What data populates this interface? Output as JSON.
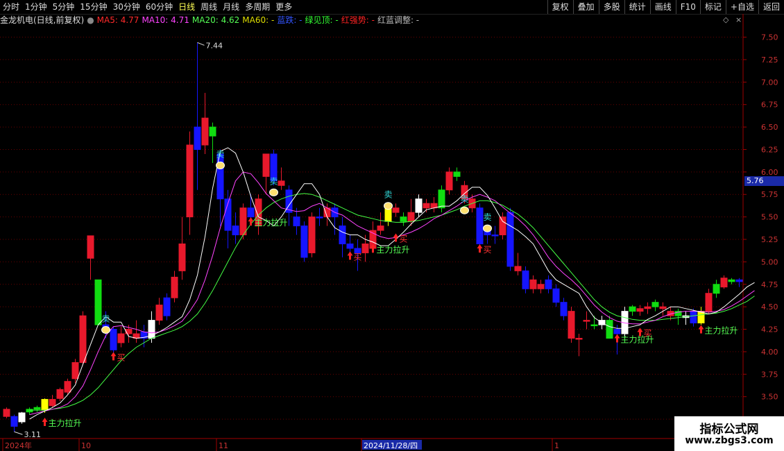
{
  "toolbar": {
    "periods": [
      "分时",
      "1分钟",
      "5分钟",
      "15分钟",
      "30分钟",
      "60分钟",
      "日线",
      "周线",
      "月线",
      "多周期",
      "更多"
    ],
    "active_index": 6,
    "right_buttons": [
      "复权",
      "叠加",
      "多股",
      "统计",
      "画线",
      "F10",
      "标记",
      "+自选",
      "返回"
    ]
  },
  "legend": {
    "title": "金龙机电(日线,前复权)",
    "ma5": "MA5: 4.77",
    "ma10": "MA10: 4.71",
    "ma20": "MA20: 4.62",
    "ma60": "MA60: -",
    "blue_fall": "蓝跌: -",
    "green_top": "绿见顶: -",
    "red_strong": "红强势: -",
    "redblue": "红蓝调整: -"
  },
  "current_price": "5.76",
  "watermark": {
    "line1": "指标公式网",
    "line2": "www.zbgs3.com"
  },
  "chart_data": {
    "type": "candlestick",
    "ylim": [
      3.05,
      7.62
    ],
    "y_ticks": [
      3.25,
      3.5,
      3.75,
      4.0,
      4.25,
      4.5,
      4.75,
      5.0,
      5.25,
      5.5,
      5.75,
      6.0,
      6.25,
      6.5,
      6.75,
      7.0,
      7.25,
      7.5
    ],
    "x_labels": [
      {
        "text": "2024年",
        "index": 0
      },
      {
        "text": "10",
        "index": 10
      },
      {
        "text": "11",
        "index": 28
      },
      {
        "text": "2024/11/28/四",
        "index": 47,
        "highlight": true
      },
      {
        "text": "1",
        "index": 72
      }
    ],
    "high_marker": {
      "text": "7.44",
      "index": 25
    },
    "low_marker": {
      "text": "3.11",
      "index": 1
    },
    "colors": {
      "red": "#e8192c",
      "blue": "#1515ff",
      "green": "#11dd11",
      "yellow": "#ffff00",
      "white": "#ffffff",
      "ma5": "#ffffff",
      "ma10": "#ff44ff",
      "ma20": "#44ff44"
    },
    "candles": [
      [
        "red",
        3.36,
        3.28,
        3.38,
        3.26
      ],
      [
        "blue",
        3.28,
        3.17,
        3.3,
        3.11
      ],
      [
        "white",
        3.22,
        3.32,
        3.33,
        3.2
      ],
      [
        "green",
        3.33,
        3.36,
        3.38,
        3.3
      ],
      [
        "green",
        3.36,
        3.38,
        3.4,
        3.33
      ],
      [
        "yellow",
        3.35,
        3.47,
        3.48,
        3.32
      ],
      [
        "red",
        3.4,
        3.47,
        3.52,
        3.38
      ],
      [
        "red",
        3.48,
        3.58,
        3.6,
        3.45
      ],
      [
        "red",
        3.55,
        3.67,
        3.7,
        3.52
      ],
      [
        "red",
        3.7,
        3.88,
        3.92,
        3.65
      ],
      [
        "red",
        3.88,
        4.4,
        4.45,
        3.85
      ],
      [
        "red",
        5.04,
        5.29,
        5.29,
        4.8
      ],
      [
        "green",
        4.8,
        4.3,
        4.8,
        4.3
      ],
      [
        "blue",
        4.3,
        4.25,
        4.45,
        4.15
      ],
      [
        "blue",
        4.25,
        4.02,
        4.28,
        3.95
      ],
      [
        "red",
        4.1,
        4.2,
        4.28,
        4.05
      ],
      [
        "red",
        4.2,
        4.25,
        4.3,
        4.1
      ],
      [
        "red",
        4.15,
        4.2,
        4.35,
        4.1
      ],
      [
        "blue",
        4.22,
        4.15,
        4.3,
        4.05
      ],
      [
        "white",
        4.15,
        4.35,
        4.45,
        4.1
      ],
      [
        "red",
        4.35,
        4.52,
        4.6,
        4.3
      ],
      [
        "blue",
        4.6,
        4.4,
        4.65,
        4.35
      ],
      [
        "red",
        4.6,
        4.83,
        4.9,
        4.55
      ],
      [
        "red",
        4.9,
        5.2,
        5.5,
        4.8
      ],
      [
        "red",
        5.5,
        6.3,
        6.45,
        5.3
      ],
      [
        "blue",
        6.5,
        6.25,
        7.44,
        5.8
      ],
      [
        "red",
        6.3,
        6.6,
        6.88,
        6.2
      ],
      [
        "green",
        6.5,
        6.4,
        6.55,
        6.1
      ],
      [
        "blue",
        6.2,
        5.7,
        6.25,
        5.4
      ],
      [
        "blue",
        5.7,
        5.35,
        5.8,
        5.15
      ],
      [
        "blue",
        5.4,
        5.3,
        5.55,
        5.2
      ],
      [
        "red",
        5.3,
        5.6,
        5.65,
        5.25
      ],
      [
        "blue",
        5.6,
        5.5,
        5.75,
        5.45
      ],
      [
        "red",
        5.4,
        5.7,
        5.75,
        5.3
      ],
      [
        "red",
        5.95,
        6.2,
        6.2,
        5.75
      ],
      [
        "blue",
        6.2,
        5.9,
        6.25,
        5.85
      ],
      [
        "red",
        5.9,
        5.85,
        6.05,
        5.8
      ],
      [
        "blue",
        5.8,
        5.55,
        5.85,
        5.4
      ],
      [
        "blue",
        5.5,
        5.4,
        5.6,
        5.3
      ],
      [
        "blue",
        5.4,
        5.05,
        5.45,
        5.0
      ],
      [
        "red",
        5.1,
        5.5,
        5.55,
        5.05
      ],
      [
        "blue",
        5.5,
        5.5,
        5.6,
        5.4
      ],
      [
        "red",
        5.5,
        5.6,
        5.65,
        5.4
      ],
      [
        "blue",
        5.6,
        5.5,
        5.65,
        5.3
      ],
      [
        "blue",
        5.4,
        5.2,
        5.5,
        5.05
      ],
      [
        "blue",
        5.2,
        5.15,
        5.3,
        5.05
      ],
      [
        "blue",
        5.15,
        5.1,
        5.25,
        4.9
      ],
      [
        "red",
        5.1,
        5.2,
        5.3,
        5.0
      ],
      [
        "red",
        5.15,
        5.35,
        5.45,
        5.1
      ],
      [
        "red",
        5.35,
        5.4,
        5.55,
        5.3
      ],
      [
        "yellow",
        5.45,
        5.6,
        5.65,
        5.4
      ],
      [
        "red",
        5.55,
        5.6,
        5.65,
        5.5
      ],
      [
        "green",
        5.5,
        5.45,
        5.55,
        5.4
      ],
      [
        "red",
        5.45,
        5.55,
        5.7,
        5.4
      ],
      [
        "white",
        5.55,
        5.7,
        5.75,
        5.5
      ],
      [
        "red",
        5.6,
        5.65,
        5.7,
        5.55
      ],
      [
        "red",
        5.65,
        5.6,
        5.72,
        5.55
      ],
      [
        "green",
        5.6,
        5.8,
        5.85,
        5.55
      ],
      [
        "red",
        5.8,
        6.0,
        6.05,
        5.75
      ],
      [
        "green",
        5.95,
        6.0,
        6.05,
        5.9
      ],
      [
        "red",
        5.85,
        5.7,
        5.9,
        5.65
      ],
      [
        "red",
        5.7,
        5.6,
        5.75,
        5.55
      ],
      [
        "blue",
        5.6,
        5.2,
        5.65,
        5.15
      ],
      [
        "blue",
        5.35,
        5.3,
        5.4,
        5.2
      ],
      [
        "blue",
        5.3,
        5.3,
        5.4,
        5.2
      ],
      [
        "red",
        5.3,
        5.5,
        5.55,
        5.25
      ],
      [
        "blue",
        5.55,
        4.95,
        5.6,
        4.9
      ],
      [
        "red",
        4.95,
        4.9,
        5.1,
        4.85
      ],
      [
        "blue",
        4.9,
        4.7,
        4.95,
        4.65
      ],
      [
        "red",
        4.8,
        4.7,
        4.85,
        4.65
      ],
      [
        "red",
        4.7,
        4.75,
        4.8,
        4.65
      ],
      [
        "blue",
        4.8,
        4.7,
        4.85,
        4.65
      ],
      [
        "blue",
        4.7,
        4.55,
        4.75,
        4.5
      ],
      [
        "blue",
        4.55,
        4.4,
        4.6,
        4.35
      ],
      [
        "red",
        4.45,
        4.15,
        4.5,
        4.1
      ],
      [
        "red",
        4.15,
        4.15,
        4.2,
        3.95
      ],
      [
        "red",
        4.35,
        4.35,
        4.45,
        4.25
      ],
      [
        "green",
        4.3,
        4.3,
        4.4,
        4.25
      ],
      [
        "white",
        4.3,
        4.35,
        4.4,
        4.25
      ],
      [
        "green",
        4.35,
        4.15,
        4.4,
        4.15
      ],
      [
        "blue",
        4.2,
        4.25,
        4.3,
        3.97
      ],
      [
        "white",
        4.2,
        4.45,
        4.5,
        4.15
      ],
      [
        "green",
        4.45,
        4.5,
        4.52,
        4.4
      ],
      [
        "red",
        4.45,
        4.48,
        4.52,
        4.4
      ],
      [
        "red",
        4.48,
        4.5,
        4.55,
        4.42
      ],
      [
        "green",
        4.5,
        4.55,
        4.58,
        4.45
      ],
      [
        "red",
        4.5,
        4.48,
        4.55,
        4.4
      ],
      [
        "red",
        4.45,
        4.4,
        4.5,
        4.35
      ],
      [
        "green",
        4.4,
        4.45,
        4.48,
        4.3
      ],
      [
        "white",
        4.38,
        4.4,
        4.45,
        4.3
      ],
      [
        "blue",
        4.32,
        4.45,
        4.48,
        4.28
      ],
      [
        "yellow",
        4.32,
        4.45,
        4.5,
        4.3
      ],
      [
        "red",
        4.45,
        4.65,
        4.7,
        4.42
      ],
      [
        "green",
        4.65,
        4.75,
        4.8,
        4.6
      ],
      [
        "red",
        4.72,
        4.82,
        4.85,
        4.7
      ],
      [
        "green",
        4.78,
        4.8,
        4.82,
        4.75
      ],
      [
        "blue",
        4.8,
        4.78,
        4.82,
        4.72
      ]
    ],
    "ma_first_index": 3,
    "ma5": [
      3.25,
      3.3,
      3.34,
      3.38,
      3.43,
      3.52,
      3.63,
      3.86,
      4.08,
      4.3,
      4.39,
      4.33,
      4.33,
      4.17,
      4.15,
      4.16,
      4.18,
      4.22,
      4.27,
      4.33,
      4.39,
      4.58,
      4.85,
      5.28,
      5.82,
      6.23,
      6.27,
      6.21,
      6.0,
      5.73,
      5.5,
      5.46,
      5.4,
      5.5,
      5.63,
      5.75,
      5.87,
      5.87,
      5.75,
      5.5,
      5.38,
      5.33,
      5.3,
      5.3,
      5.25,
      5.22,
      5.18,
      5.18,
      5.25,
      5.33,
      5.42,
      5.5,
      5.58,
      5.6,
      5.62,
      5.62,
      5.68,
      5.76,
      5.83,
      5.83,
      5.74,
      5.6,
      5.45,
      5.4,
      5.35,
      5.28,
      5.2,
      5.05,
      4.9,
      4.8,
      4.75,
      4.7,
      4.65,
      4.5,
      4.38,
      4.32,
      4.28,
      4.26,
      4.26,
      4.28,
      4.3,
      4.36,
      4.4,
      4.45,
      4.5,
      4.5,
      4.48,
      4.46,
      4.44,
      4.42,
      4.44,
      4.5,
      4.57,
      4.64,
      4.72,
      4.77
    ],
    "ma10": [
      3.3,
      3.32,
      3.34,
      3.36,
      3.38,
      3.42,
      3.5,
      3.62,
      3.8,
      4.0,
      4.18,
      4.28,
      4.29,
      4.27,
      4.25,
      4.22,
      4.21,
      4.22,
      4.25,
      4.29,
      4.34,
      4.45,
      4.58,
      4.8,
      5.07,
      5.38,
      5.65,
      5.9,
      6.0,
      5.98,
      5.88,
      5.76,
      5.68,
      5.6,
      5.58,
      5.56,
      5.57,
      5.62,
      5.65,
      5.6,
      5.55,
      5.52,
      5.46,
      5.4,
      5.36,
      5.32,
      5.28,
      5.26,
      5.27,
      5.3,
      5.33,
      5.37,
      5.42,
      5.48,
      5.52,
      5.57,
      5.62,
      5.68,
      5.72,
      5.75,
      5.72,
      5.68,
      5.61,
      5.54,
      5.48,
      5.4,
      5.3,
      5.18,
      5.05,
      4.95,
      4.87,
      4.8,
      4.72,
      4.62,
      4.52,
      4.44,
      4.38,
      4.34,
      4.32,
      4.31,
      4.31,
      4.33,
      4.35,
      4.39,
      4.42,
      4.44,
      4.45,
      4.45,
      4.45,
      4.44,
      4.45,
      4.47,
      4.51,
      4.56,
      4.62,
      4.68
    ],
    "ma20": [
      3.35,
      3.35,
      3.35,
      3.36,
      3.37,
      3.39,
      3.42,
      3.46,
      3.52,
      3.6,
      3.7,
      3.8,
      3.9,
      3.98,
      4.05,
      4.1,
      4.15,
      4.18,
      4.21,
      4.24,
      4.28,
      4.34,
      4.42,
      4.54,
      4.68,
      4.84,
      5.0,
      5.16,
      5.3,
      5.42,
      5.52,
      5.6,
      5.66,
      5.7,
      5.73,
      5.75,
      5.76,
      5.75,
      5.72,
      5.68,
      5.64,
      5.6,
      5.56,
      5.52,
      5.5,
      5.48,
      5.46,
      5.45,
      5.44,
      5.44,
      5.45,
      5.46,
      5.48,
      5.5,
      5.52,
      5.55,
      5.58,
      5.62,
      5.65,
      5.68,
      5.68,
      5.66,
      5.63,
      5.58,
      5.53,
      5.46,
      5.38,
      5.28,
      5.18,
      5.08,
      4.98,
      4.88,
      4.78,
      4.68,
      4.58,
      4.5,
      4.44,
      4.4,
      4.38,
      4.36,
      4.35,
      4.35,
      4.35,
      4.36,
      4.37,
      4.38,
      4.39,
      4.4,
      4.41,
      4.42,
      4.43,
      4.45,
      4.48,
      4.52,
      4.56,
      4.62
    ]
  },
  "signals": [
    {
      "type": "buy_main",
      "index": 5,
      "text": "主力拉升",
      "price": 3.22
    },
    {
      "type": "buy",
      "index": 14,
      "text": "买",
      "price": 3.95
    },
    {
      "type": "sell",
      "index": 13,
      "text": "卖",
      "price": 4.32
    },
    {
      "type": "sell",
      "index": 28,
      "text": "卖",
      "price": 6.15
    },
    {
      "type": "buy_main",
      "index": 32,
      "text": "主力拉升",
      "price": 5.45
    },
    {
      "type": "sell",
      "index": 35,
      "text": "卖",
      "price": 5.85
    },
    {
      "type": "buy",
      "index": 45,
      "text": "买",
      "price": 5.07
    },
    {
      "type": "buy_main",
      "index": 48,
      "text": "主力拉升",
      "price": 5.15
    },
    {
      "type": "sell",
      "index": 50,
      "text": "卖",
      "price": 5.7
    },
    {
      "type": "buy",
      "index": 51,
      "text": "买",
      "price": 5.27
    },
    {
      "type": "sell",
      "index": 60,
      "text": "卖",
      "price": 5.65
    },
    {
      "type": "buy",
      "index": 62,
      "text": "买",
      "price": 5.15
    },
    {
      "type": "sell",
      "index": 63,
      "text": "卖",
      "price": 5.45
    },
    {
      "type": "buy_main",
      "index": 80,
      "text": "主力拉升",
      "price": 4.15
    },
    {
      "type": "buy",
      "index": 83,
      "text": "买",
      "price": 4.22
    },
    {
      "type": "buy_main",
      "index": 91,
      "text": "主力拉升",
      "price": 4.25
    }
  ]
}
